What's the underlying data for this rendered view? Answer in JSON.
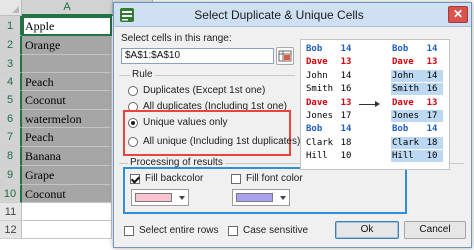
{
  "spreadsheet": {
    "columns": [
      "A",
      "B"
    ],
    "rows": [
      {
        "num": "1",
        "value": "Apple",
        "state": "active"
      },
      {
        "num": "2",
        "value": "Orange",
        "state": "shaded"
      },
      {
        "num": "3",
        "value": "",
        "state": "shaded"
      },
      {
        "num": "4",
        "value": "Peach",
        "state": "shaded"
      },
      {
        "num": "5",
        "value": "Coconut",
        "state": "shaded"
      },
      {
        "num": "6",
        "value": "watermelon",
        "state": "shaded"
      },
      {
        "num": "7",
        "value": "Peach",
        "state": "shaded"
      },
      {
        "num": "8",
        "value": "Banana",
        "state": "shaded"
      },
      {
        "num": "9",
        "value": "Grape",
        "state": "shaded"
      },
      {
        "num": "10",
        "value": "Coconut",
        "state": "shaded"
      },
      {
        "num": "11",
        "value": "",
        "state": "plain"
      },
      {
        "num": "12",
        "value": "",
        "state": "plain"
      }
    ]
  },
  "dialog": {
    "title": "Select Duplicate & Unique Cells",
    "close_symbol": "✕",
    "range_label": "Select cells in this range:",
    "range_value": "$A$1:$A$10",
    "rule_legend": "Rule",
    "rules": [
      {
        "label": "Duplicates (Except 1st one)",
        "selected": false
      },
      {
        "label": "All duplicates (Including 1st one)",
        "selected": false
      },
      {
        "label": "Unique values only",
        "selected": true
      },
      {
        "label": "All unique (Including 1st duplicates)",
        "selected": false
      }
    ],
    "processing_legend": "Processing of results",
    "fill_backcolor_label": "Fill backcolor",
    "fill_backcolor_checked": true,
    "fill_backcolor_color": "#f7c3cc",
    "fill_font_label": "Fill font color",
    "fill_font_checked": false,
    "fill_font_color": "#a8a2ee",
    "select_rows_label": "Select entire rows",
    "select_rows_checked": false,
    "case_sensitive_label": "Case sensitive",
    "case_sensitive_checked": false,
    "ok_label": "Ok",
    "cancel_label": "Cancel"
  },
  "preview": {
    "left": [
      {
        "name": "Bob",
        "num": "14",
        "style": "first"
      },
      {
        "name": "Dave",
        "num": "13",
        "style": "dup"
      },
      {
        "name": "John",
        "num": "14",
        "style": "plain"
      },
      {
        "name": "Smith",
        "num": "16",
        "style": "plain"
      },
      {
        "name": "Dave",
        "num": "13",
        "style": "dup"
      },
      {
        "name": "Jones",
        "num": "17",
        "style": "plain"
      },
      {
        "name": "Bob",
        "num": "14",
        "style": "first"
      },
      {
        "name": "Clark",
        "num": "18",
        "style": "plain"
      },
      {
        "name": "Hill",
        "num": "10",
        "style": "plain"
      }
    ],
    "right": [
      {
        "name": "Bob",
        "num": "14",
        "style": "first",
        "highlight": false
      },
      {
        "name": "Dave",
        "num": "13",
        "style": "dup",
        "highlight": false
      },
      {
        "name": "John",
        "num": "14",
        "style": "plain",
        "highlight": true
      },
      {
        "name": "Smith",
        "num": "16",
        "style": "plain",
        "highlight": true
      },
      {
        "name": "Dave",
        "num": "13",
        "style": "dup",
        "highlight": false
      },
      {
        "name": "Jones",
        "num": "17",
        "style": "plain",
        "highlight": true
      },
      {
        "name": "Bob",
        "num": "14",
        "style": "first",
        "highlight": false
      },
      {
        "name": "Clark",
        "num": "18",
        "style": "plain",
        "highlight": true
      },
      {
        "name": "Hill",
        "num": "10",
        "style": "plain",
        "highlight": true
      }
    ]
  },
  "colors": {
    "accent_red": "#e8463d",
    "accent_blue": "#2f8fd8",
    "excel_green": "#217346"
  }
}
